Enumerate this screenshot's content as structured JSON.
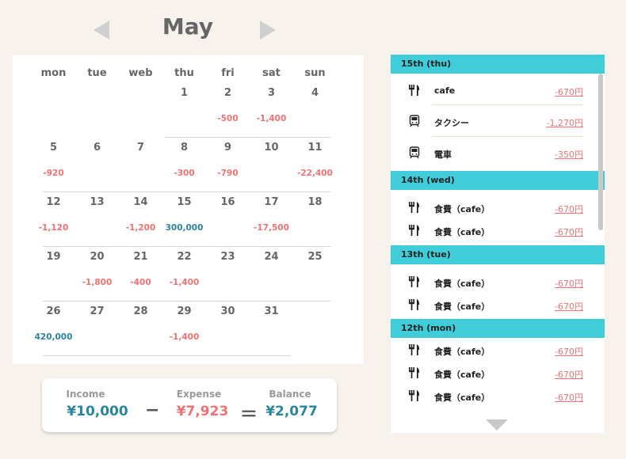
{
  "month": {
    "title": "May",
    "prev_icon": "triangle-left-icon",
    "next_icon": "triangle-right-icon"
  },
  "calendar": {
    "weekdays": [
      "mon",
      "tue",
      "web",
      "thu",
      "fri",
      "sat",
      "sun"
    ],
    "days": [
      {
        "d": "1",
        "amount": "",
        "kind": ""
      },
      {
        "d": "2",
        "amount": "-500",
        "kind": "expense"
      },
      {
        "d": "3",
        "amount": "-1,400",
        "kind": "expense"
      },
      {
        "d": "4",
        "amount": "",
        "kind": ""
      },
      {
        "d": "5",
        "amount": "-920",
        "kind": "expense"
      },
      {
        "d": "6",
        "amount": "",
        "kind": ""
      },
      {
        "d": "7",
        "amount": "",
        "kind": ""
      },
      {
        "d": "8",
        "amount": "-300",
        "kind": "expense"
      },
      {
        "d": "9",
        "amount": "-790",
        "kind": "expense"
      },
      {
        "d": "10",
        "amount": "",
        "kind": ""
      },
      {
        "d": "11",
        "amount": "-22,400",
        "kind": "expense"
      },
      {
        "d": "12",
        "amount": "-1,120",
        "kind": "expense"
      },
      {
        "d": "13",
        "amount": "",
        "kind": ""
      },
      {
        "d": "14",
        "amount": "-1,200",
        "kind": "expense"
      },
      {
        "d": "15",
        "amount": "300,000",
        "kind": "income"
      },
      {
        "d": "16",
        "amount": "",
        "kind": ""
      },
      {
        "d": "17",
        "amount": "-17,500",
        "kind": "expense"
      },
      {
        "d": "18",
        "amount": "",
        "kind": ""
      },
      {
        "d": "19",
        "amount": "",
        "kind": ""
      },
      {
        "d": "20",
        "amount": "-1,800",
        "kind": "expense"
      },
      {
        "d": "21",
        "amount": "-400",
        "kind": "expense"
      },
      {
        "d": "22",
        "amount": "-1,400",
        "kind": "expense"
      },
      {
        "d": "23",
        "amount": "",
        "kind": ""
      },
      {
        "d": "24",
        "amount": "",
        "kind": ""
      },
      {
        "d": "25",
        "amount": "",
        "kind": ""
      },
      {
        "d": "26",
        "amount": "420,000",
        "kind": "income"
      },
      {
        "d": "27",
        "amount": "",
        "kind": ""
      },
      {
        "d": "28",
        "amount": "",
        "kind": ""
      },
      {
        "d": "29",
        "amount": "-1,400",
        "kind": "expense"
      },
      {
        "d": "30",
        "amount": "",
        "kind": ""
      },
      {
        "d": "31",
        "amount": "",
        "kind": ""
      }
    ]
  },
  "summary": {
    "income_label": "Income",
    "income": "¥10,000",
    "expense_label": "Expense",
    "expense": "¥7,923",
    "balance_label": "Balance",
    "balance": "¥2,077",
    "minus": "−",
    "equals": "＝"
  },
  "transactions": [
    {
      "header": "15th (thu)",
      "items": [
        {
          "icon": "fork-knife-icon",
          "name": "cafe",
          "amount": "-670円"
        },
        {
          "icon": "train-icon",
          "name": "タクシー",
          "amount": "-1,270円"
        },
        {
          "icon": "train-icon",
          "name": "電車",
          "amount": "-350円"
        }
      ]
    },
    {
      "header": "14th (wed)",
      "items": [
        {
          "icon": "fork-knife-icon",
          "name": "食費（cafe）",
          "amount": "-670円"
        },
        {
          "icon": "fork-knife-icon",
          "name": "食費（cafe）",
          "amount": "-670円"
        }
      ]
    },
    {
      "header": "13th (tue)",
      "items": [
        {
          "icon": "fork-knife-icon",
          "name": "食費（cafe）",
          "amount": "-670円"
        },
        {
          "icon": "fork-knife-icon",
          "name": "食費（cafe）",
          "amount": "-670円"
        }
      ]
    },
    {
      "header": "12th (mon)",
      "items": [
        {
          "icon": "fork-knife-icon",
          "name": "食費（cafe）",
          "amount": "-670円"
        },
        {
          "icon": "fork-knife-icon",
          "name": "食費（cafe）",
          "amount": "-670円"
        },
        {
          "icon": "fork-knife-icon",
          "name": "食費（cafe）",
          "amount": "-670円"
        }
      ]
    }
  ],
  "colors": {
    "header": "#3ecdd9",
    "expense": "#f07272",
    "income": "#2a86a0"
  }
}
